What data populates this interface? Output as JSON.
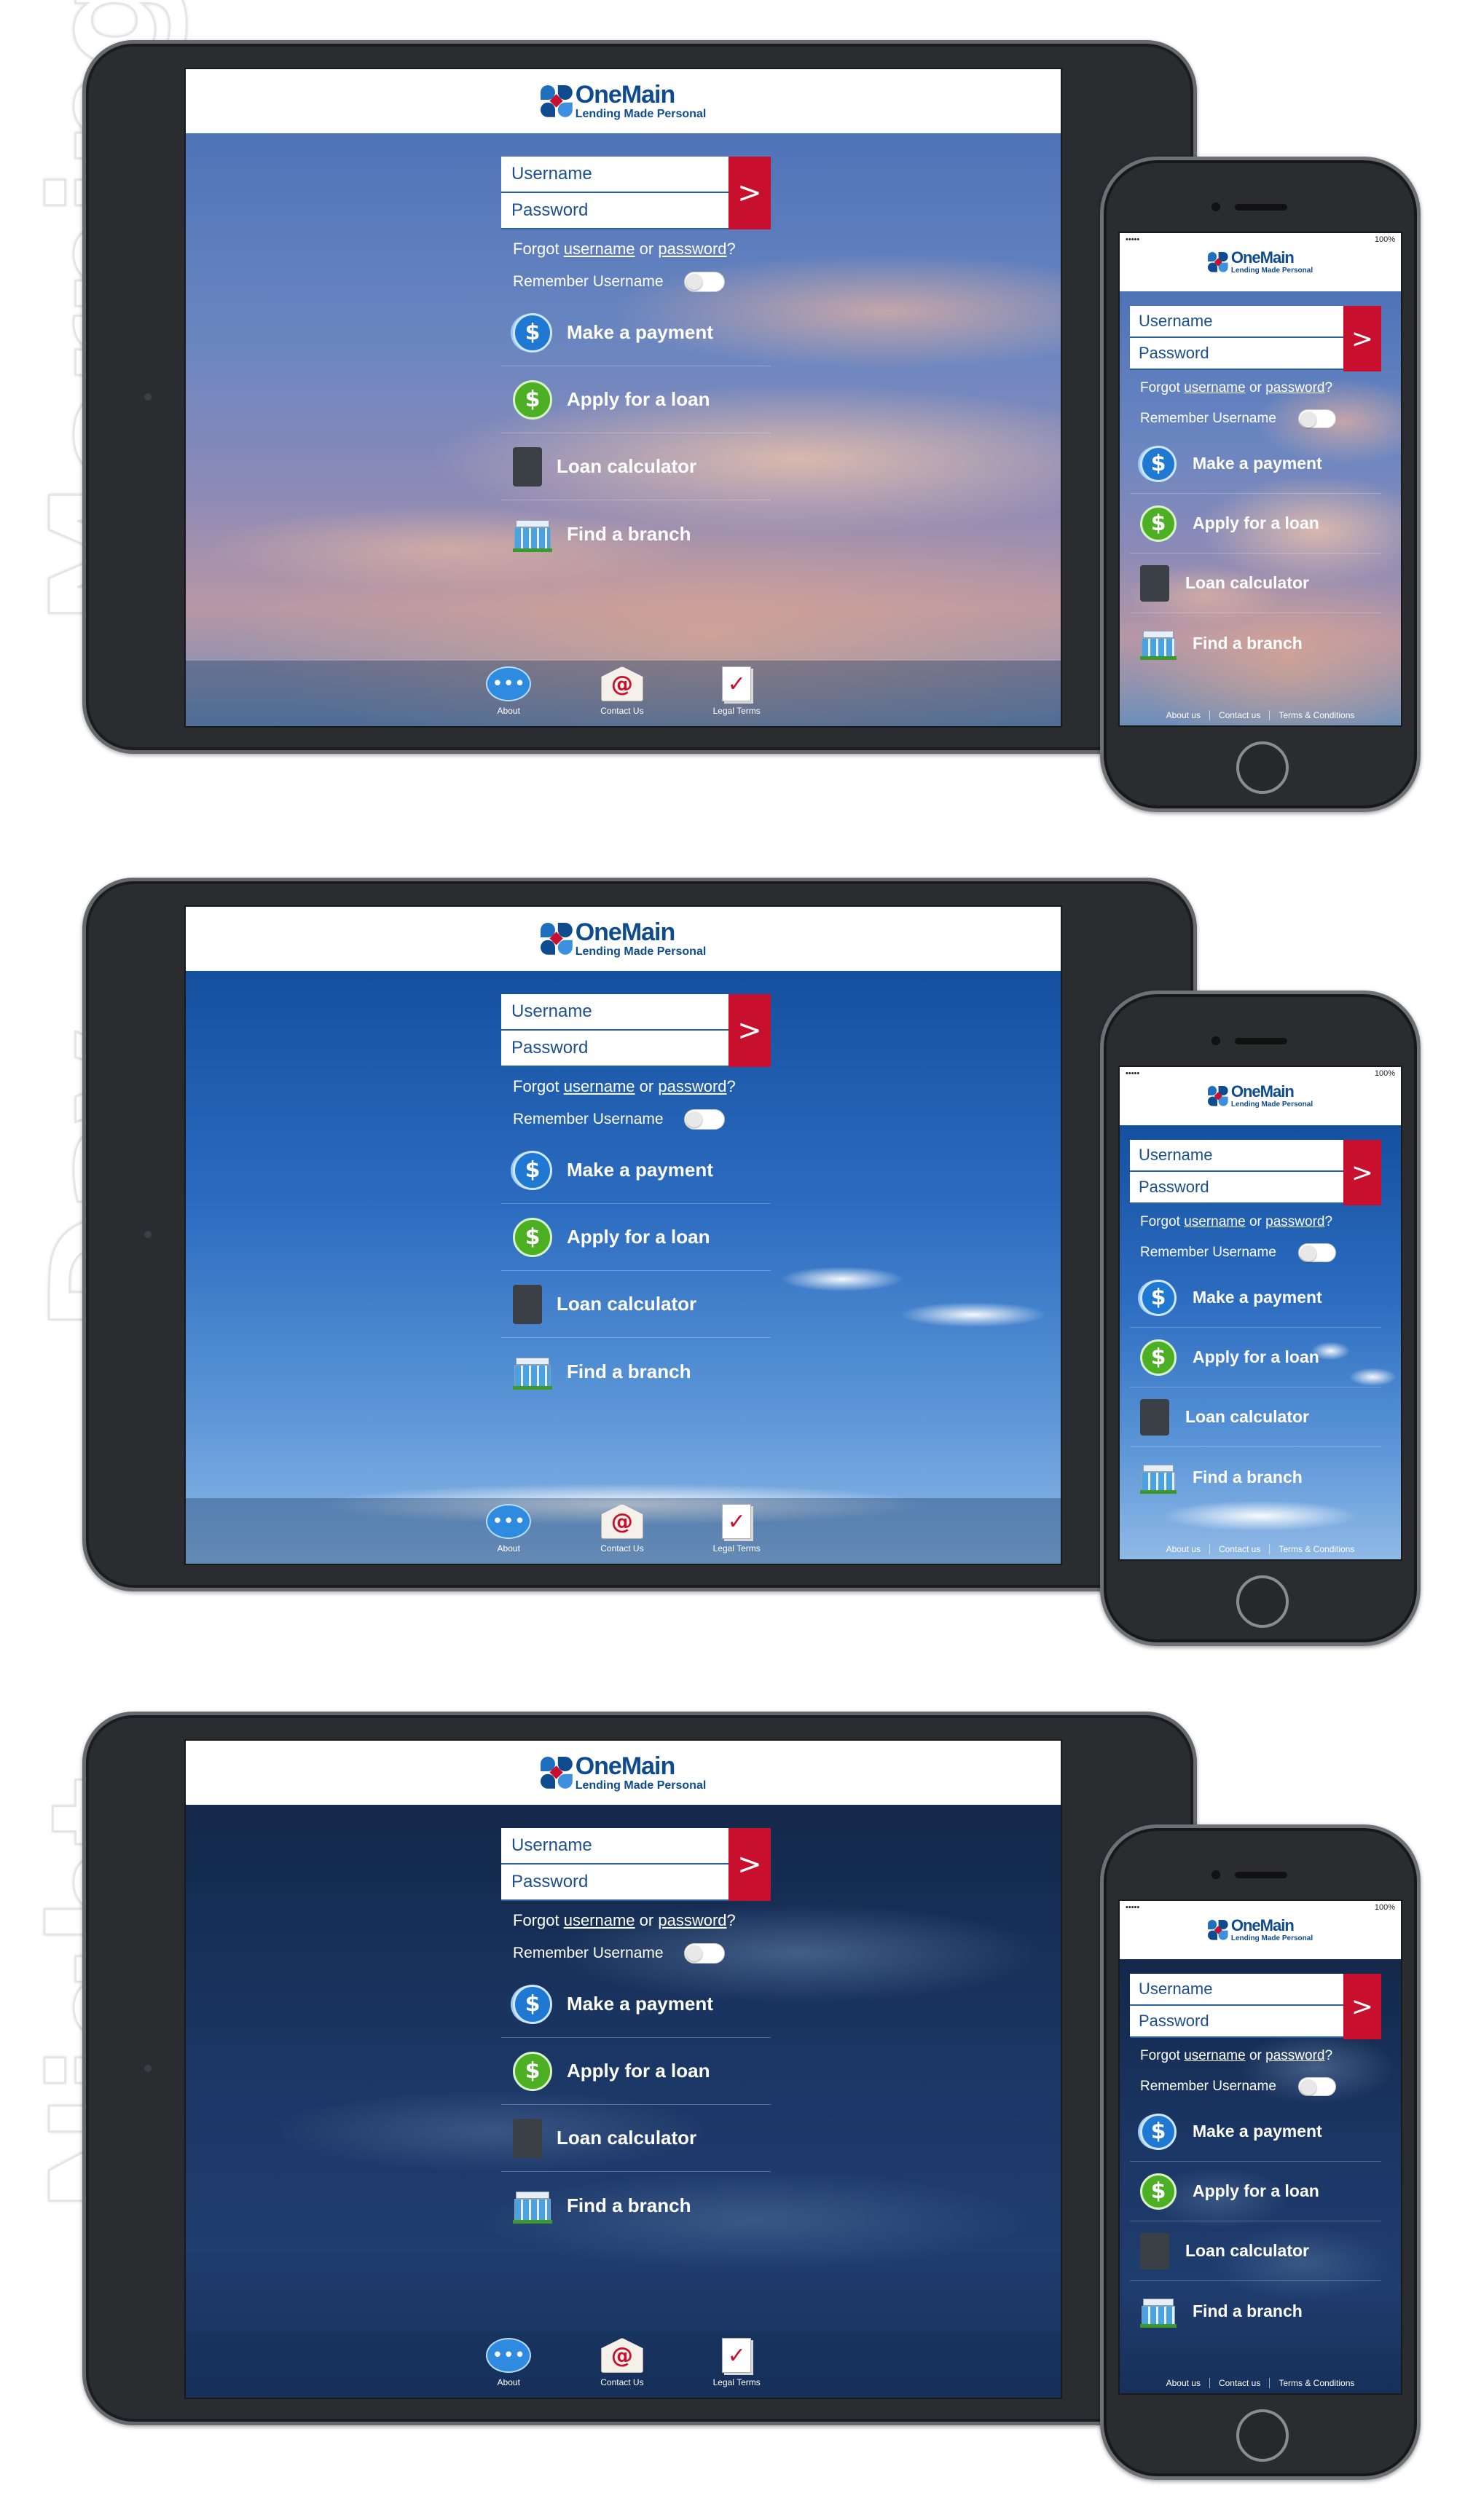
{
  "themes": [
    {
      "label": "Morning"
    },
    {
      "label": "Day"
    },
    {
      "label": "Night"
    }
  ],
  "brand": {
    "name": "OneMain",
    "tagline": "Lending Made Personal",
    "color": "#0e4b8f",
    "accent": "#c8102e"
  },
  "status_bar": {
    "carrier": "•••••",
    "battery": "100%"
  },
  "login": {
    "username_placeholder": "Username",
    "password_placeholder": "Password",
    "submit_label": ">",
    "forgot_prefix": "Forgot ",
    "forgot_username": "username",
    "forgot_or": " or ",
    "forgot_password": "password",
    "forgot_suffix": "?",
    "remember_label": "Remember Username"
  },
  "menu": [
    {
      "label": "Make a payment",
      "icon": "payment-icon",
      "glyph": "$"
    },
    {
      "label": "Apply for a loan",
      "icon": "dollar-icon",
      "glyph": "$"
    },
    {
      "label": "Loan calculator",
      "icon": "calculator-icon"
    },
    {
      "label": "Find a branch",
      "icon": "branch-icon"
    }
  ],
  "tablet_footer": [
    {
      "label": "About",
      "icon": "chat-bubble-icon",
      "glyph": "•••"
    },
    {
      "label": "Contact Us",
      "icon": "envelope-icon",
      "glyph": "@"
    },
    {
      "label": "Legal Terms",
      "icon": "document-check-icon",
      "glyph": "✓"
    }
  ],
  "phone_footer": [
    {
      "label": "About us"
    },
    {
      "label": "Contact us"
    },
    {
      "label": "Terms & Conditions"
    }
  ]
}
